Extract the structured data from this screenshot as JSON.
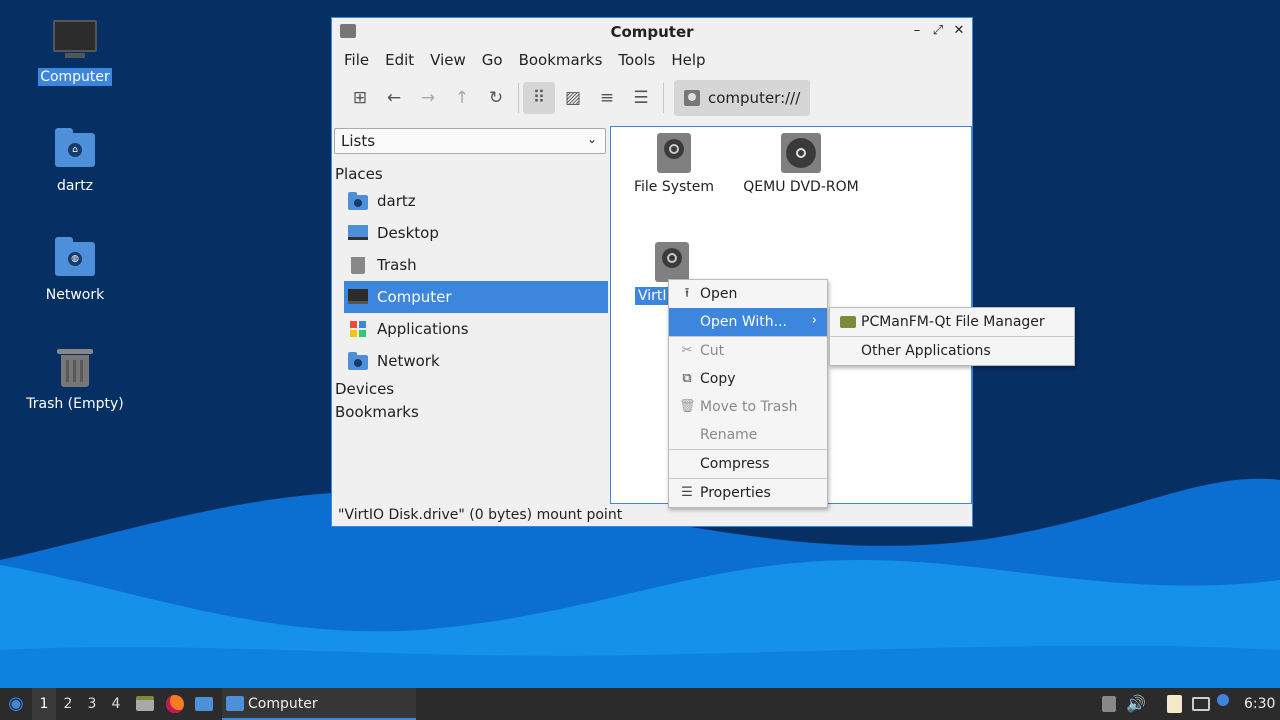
{
  "desktop": {
    "icons": [
      {
        "label": "Computer",
        "icon": "computer-icon",
        "selected": true
      },
      {
        "label": "dartz",
        "icon": "home-folder-icon"
      },
      {
        "label": "Network",
        "icon": "network-folder-icon"
      },
      {
        "label": "Trash (Empty)",
        "icon": "trash-icon"
      }
    ]
  },
  "window": {
    "title": "Computer",
    "controls": {
      "minimize": "–",
      "maximize": "⤢",
      "close": "✕"
    },
    "menubar": [
      "File",
      "Edit",
      "View",
      "Go",
      "Bookmarks",
      "Tools",
      "Help"
    ],
    "toolbar": {
      "new_tab": "⊞",
      "back": "←",
      "forward": "→",
      "up": "↑",
      "reload": "↻",
      "icon_view": "⠿",
      "thumbnail_view": "▨",
      "compact_view": "≡",
      "detailed_view": "☰",
      "location": "computer:///"
    },
    "sidepane": {
      "selector": "Lists",
      "places_heading": "Places",
      "places": [
        {
          "label": "dartz",
          "icon": "home-folder-icon"
        },
        {
          "label": "Desktop",
          "icon": "desktop-icon"
        },
        {
          "label": "Trash",
          "icon": "trash-icon"
        },
        {
          "label": "Computer",
          "icon": "computer-icon",
          "selected": true
        },
        {
          "label": "Applications",
          "icon": "applications-icon"
        },
        {
          "label": "Network",
          "icon": "network-folder-icon"
        }
      ],
      "devices_heading": "Devices",
      "bookmarks_heading": "Bookmarks"
    },
    "files": [
      {
        "label": "File System",
        "icon": "drive-icon"
      },
      {
        "label": "QEMU DVD-ROM",
        "icon": "optical-disc-icon"
      },
      {
        "label": "VirtIO Disk",
        "display": "VirtI",
        "icon": "drive-icon",
        "selected": true
      }
    ],
    "status": "\"VirtIO Disk.drive\" (0 bytes) mount point"
  },
  "context_menu": {
    "items": [
      {
        "label": "Open",
        "icon": "open-icon"
      },
      {
        "label": "Open With...",
        "highlighted": true
      },
      {
        "label": "Cut",
        "icon": "cut-icon",
        "disabled": true
      },
      {
        "label": "Copy",
        "icon": "copy-icon"
      },
      {
        "label": "Move to Trash",
        "icon": "trash-icon",
        "disabled": true
      },
      {
        "label": "Rename",
        "disabled": true
      },
      {
        "label": "Compress"
      },
      {
        "label": "Properties",
        "icon": "properties-icon"
      }
    ]
  },
  "submenu": {
    "items": [
      {
        "label": "PCManFM-Qt File Manager",
        "icon": "file-manager-icon"
      },
      {
        "label": "Other Applications"
      }
    ]
  },
  "taskbar": {
    "workspaces": [
      "1",
      "2",
      "3",
      "4"
    ],
    "task": "Computer",
    "clock": "6:30"
  }
}
